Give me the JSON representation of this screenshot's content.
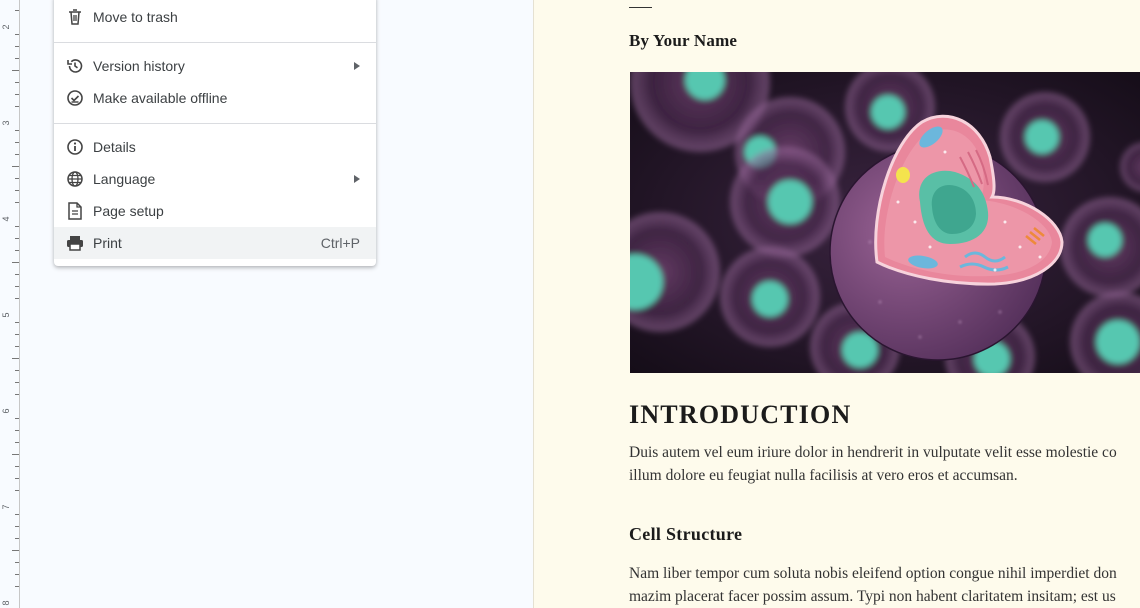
{
  "ruler": {
    "labels": [
      "2",
      "3",
      "4",
      "5",
      "6",
      "7",
      "8"
    ]
  },
  "menu": {
    "items": [
      {
        "label": "Move to trash",
        "icon": "trash-icon"
      },
      {
        "label": "Version history",
        "icon": "history-icon",
        "submenu": true
      },
      {
        "label": "Make available offline",
        "icon": "offline-check-icon"
      },
      {
        "label": "Details",
        "icon": "info-icon"
      },
      {
        "label": "Language",
        "icon": "globe-icon",
        "submenu": true
      },
      {
        "label": "Page setup",
        "icon": "page-icon"
      },
      {
        "label": "Print",
        "icon": "printer-icon",
        "shortcut": "Ctrl+P",
        "highlighted": true
      }
    ]
  },
  "document": {
    "byline": "By Your Name",
    "intro_heading": "INTRODUCTION",
    "intro_paragraph": [
      "Duis autem vel eum iriure dolor in hendrerit in vulputate velit esse molestie co",
      "illum dolore eu feugiat nulla facilisis at vero eros et accumsan."
    ],
    "cell_heading": "Cell Structure",
    "cell_paragraph": [
      "Nam liber tempor cum soluta nobis eleifend option congue nihil imperdiet don",
      "mazim placerat facer possim assum. Typi non habent claritatem insitam; est us"
    ]
  },
  "colors": {
    "page_background": "#fefbec",
    "workspace_background": "#f8fbff",
    "menu_hover": "#f1f3f4",
    "image_dark": "#221426",
    "cell_teal": "#5fcdb8",
    "cell_pink": "#e9879c",
    "cell_purple": "#7a4a74"
  }
}
